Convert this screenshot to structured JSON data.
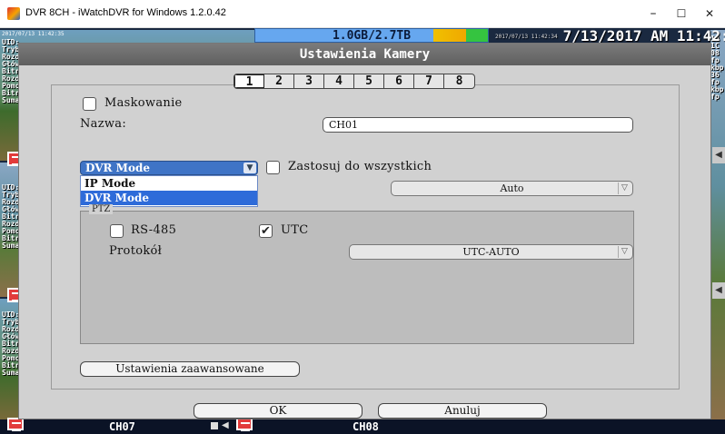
{
  "window": {
    "title": "DVR 8CH - iWatchDVR for Windows 1.2.0.42",
    "min": "–",
    "max": "☐",
    "close": "✕"
  },
  "status": {
    "storage": "1.0GB/2.7TB",
    "clock_small": "2017/07/13 11:42:34",
    "clock": "7/13/2017 AM 11:42:34"
  },
  "cam_overlay": {
    "timestamp": "2017/07/13 11:42:35",
    "lines": "UID:\nTryb:\nRozd\nGłów\nBitra\nRozd\nPomc\nBitra\nSuma"
  },
  "right_overlay": {
    "lines": "10\n1C\n08\nfp\nkbp\n36\nfp\nkbp\nfp"
  },
  "channels": {
    "ch07": "CH07",
    "ch08": "CH08"
  },
  "dialog": {
    "title": "Ustawienia Kamery",
    "tabs": [
      "1",
      "2",
      "3",
      "4",
      "5",
      "6",
      "7",
      "8"
    ],
    "active_tab": "1",
    "masking_label": "Maskowanie",
    "name_label": "Nazwa:",
    "name_value": "CH01",
    "mode_selected": "DVR Mode",
    "mode_options": [
      "IP Mode",
      "DVR Mode"
    ],
    "apply_all_label": "Zastosuj do wszystkich",
    "auto_value": "Auto",
    "ptz_label": "PTZ",
    "rs485_label": "RS-485",
    "utc_label": "UTC",
    "utc_checked": "✔",
    "protocol_label": "Protokół",
    "protocol_value": "UTC-AUTO",
    "advanced_label": "Ustawienia zaawansowane",
    "ok_label": "OK",
    "cancel_label": "Anuluj"
  }
}
